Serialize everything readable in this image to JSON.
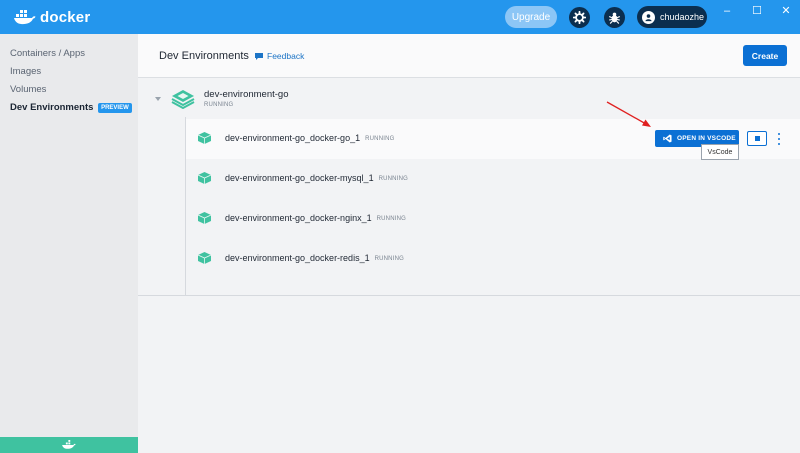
{
  "app": {
    "name": "docker"
  },
  "titlebar": {
    "upgrade_label": "Upgrade",
    "settings_icon": "gear-icon",
    "troubleshoot_icon": "bug-icon",
    "username": "chudaozhe",
    "window_controls": {
      "minimize": "–",
      "maximize": "☐",
      "close": "✕"
    }
  },
  "sidebar": {
    "items": [
      {
        "label": "Containers / Apps",
        "active": false
      },
      {
        "label": "Images",
        "active": false
      },
      {
        "label": "Volumes",
        "active": false
      },
      {
        "label": "Dev Environments",
        "active": true,
        "badge": "PREVIEW"
      }
    ]
  },
  "header": {
    "title": "Dev Environments",
    "feedback_label": "Feedback",
    "create_label": "Create"
  },
  "environment": {
    "name": "dev-environment-go",
    "status": "RUNNING",
    "containers": [
      {
        "name": "dev-environment-go_docker-go_1",
        "status": "RUNNING"
      },
      {
        "name": "dev-environment-go_docker-mysql_1",
        "status": "RUNNING"
      },
      {
        "name": "dev-environment-go_docker-nginx_1",
        "status": "RUNNING"
      },
      {
        "name": "dev-environment-go_docker-redis_1",
        "status": "RUNNING"
      }
    ]
  },
  "actions": {
    "open_vscode_label": "OPEN IN VSCODE",
    "tooltip": "VsCode"
  },
  "colors": {
    "brand": "#2496ed",
    "dark_navy": "#0b2e4f",
    "action_blue": "#0b70d4",
    "accent_green": "#3fc2a0",
    "annotation_red": "#e02020"
  }
}
